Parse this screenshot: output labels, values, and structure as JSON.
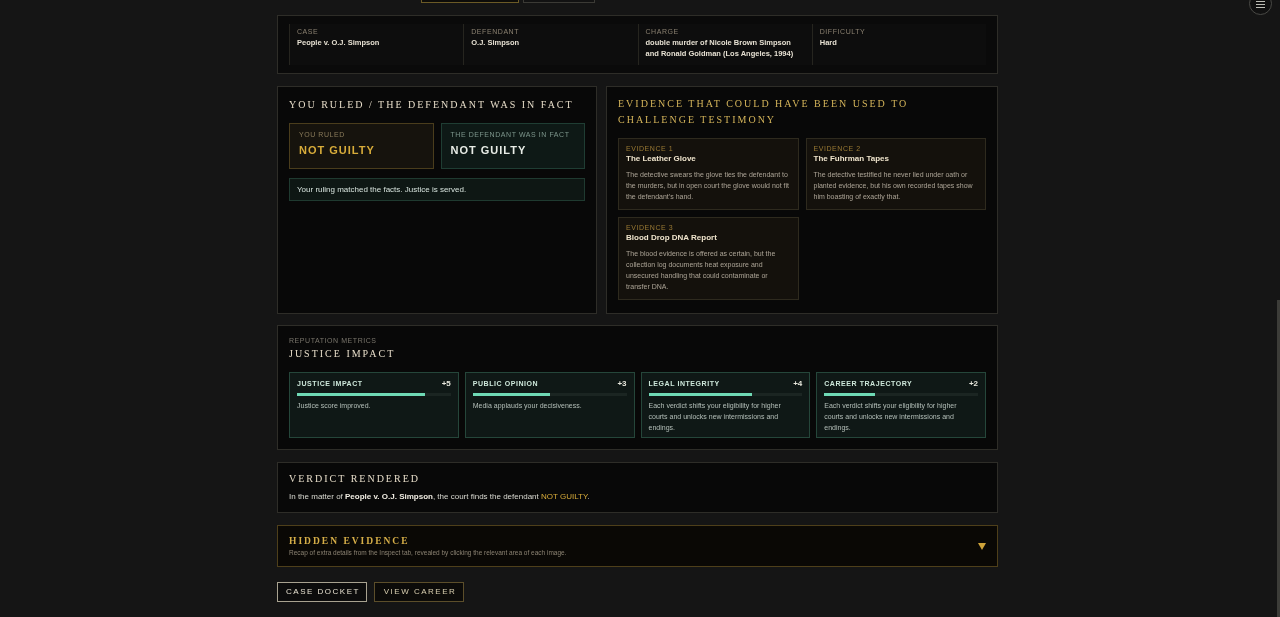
{
  "top_buttons": [
    {
      "selected": true
    },
    {
      "selected": false
    }
  ],
  "case_info": [
    {
      "label": "CASE",
      "value": "People v. O.J. Simpson"
    },
    {
      "label": "DEFENDANT",
      "value": "O.J. Simpson"
    },
    {
      "label": "CHARGE",
      "value": "double murder of Nicole Brown Simpson and Ronald Goldman (Los Angeles, 1994)"
    },
    {
      "label": "DIFFICULTY",
      "value": "Hard"
    }
  ],
  "ruling": {
    "title": "YOU RULED / THE DEFENDANT WAS IN FACT",
    "boxes": [
      {
        "kind": "ruled",
        "label": "YOU RULED",
        "value": "NOT GUILTY"
      },
      {
        "kind": "fact",
        "label": "THE DEFENDANT WAS IN FACT",
        "value": "NOT GUILTY"
      }
    ],
    "message": "Your ruling matched the facts. Justice is served."
  },
  "evidence": {
    "title": "EVIDENCE THAT COULD HAVE BEEN USED TO CHALLENGE TESTIMONY",
    "items": [
      {
        "label": "EVIDENCE 1",
        "title": "The Leather Glove",
        "description": "The detective swears the glove ties the defendant to the murders, but in open court the glove would not fit the defendant’s hand."
      },
      {
        "label": "EVIDENCE 2",
        "title": "The Fuhrman Tapes",
        "description": "The detective testified he never lied under oath or planted evidence, but his own recorded tapes show him boasting of exactly that."
      },
      {
        "label": "EVIDENCE 3",
        "title": "Blood Drop DNA Report",
        "description": "The blood evidence is offered as certain, but the collection log documents heat exposure and unsecured handling that could contaminate or transfer DNA."
      }
    ]
  },
  "metrics": {
    "eyebrow": "REPUTATION METRICS",
    "title": "JUSTICE IMPACT",
    "items": [
      {
        "label": "JUSTICE IMPACT",
        "value": "+5",
        "level": 0.83,
        "description": "Justice score improved."
      },
      {
        "label": "PUBLIC OPINION",
        "value": "+3",
        "level": 0.5,
        "description": "Media applauds your decisiveness."
      },
      {
        "label": "LEGAL INTEGRITY",
        "value": "+4",
        "level": 0.67,
        "description": "Each verdict shifts your eligibility for higher courts and unlocks new intermissions and endings."
      },
      {
        "label": "CAREER TRAJECTORY",
        "value": "+2",
        "level": 0.33,
        "description": "Each verdict shifts your eligibility for higher courts and unlocks new intermissions and endings."
      }
    ]
  },
  "verdict": {
    "title": "VERDICT RENDERED",
    "sentence": [
      {
        "kind": "plain",
        "text": "In the matter of "
      },
      {
        "kind": "case",
        "text": "People v. O.J. Simpson"
      },
      {
        "kind": "plain",
        "text": ", the court finds the defendant "
      },
      {
        "kind": "verdict",
        "text": "NOT GUILTY"
      },
      {
        "kind": "plain",
        "text": "."
      }
    ]
  },
  "hidden_evidence": {
    "title": "HIDDEN EVIDENCE",
    "subtitle": "Recap of extra details from the Inspect tab, revealed by clicking the relevant area of each image.",
    "expanded": false
  },
  "actions": [
    {
      "kind": "outline",
      "label": "CASE DOCKET"
    },
    {
      "kind": "gold",
      "label": "VIEW CAREER"
    }
  ]
}
